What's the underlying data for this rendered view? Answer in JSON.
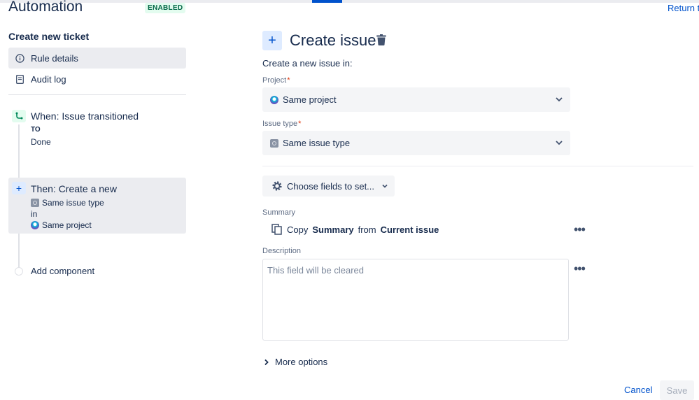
{
  "header": {
    "app_title": "Automation",
    "status_badge": "ENABLED",
    "return_link": "Return t"
  },
  "sidebar": {
    "rule_name": "Create new ticket",
    "nav": [
      {
        "label": "Rule details",
        "icon": "info-icon"
      },
      {
        "label": "Audit log",
        "icon": "document-icon"
      }
    ],
    "trigger": {
      "title": "When: Issue transitioned",
      "to_label": "TO",
      "to_value": "Done"
    },
    "action": {
      "title": "Then: Create a new",
      "issue_type": "Same issue type",
      "in_label": "in",
      "project": "Same project"
    },
    "add_component": "Add component"
  },
  "main": {
    "title": "Create issue",
    "subtitle": "Create a new issue in:",
    "project_label": "Project",
    "project_value": "Same project",
    "issue_type_label": "Issue type",
    "issue_type_value": "Same issue type",
    "choose_fields": "Choose fields to set...",
    "summary_label": "Summary",
    "summary_copy": {
      "prefix": "Copy",
      "field": "Summary",
      "middle": "from",
      "source": "Current issue"
    },
    "description_label": "Description",
    "description_placeholder": "This field will be cleared",
    "more_options": "More options",
    "required_mark": "*"
  },
  "footer": {
    "cancel": "Cancel",
    "save": "Save"
  },
  "colors": {
    "primary": "#0052cc",
    "text": "#172b4d",
    "badge_bg": "#e3fcef",
    "badge_text": "#006644",
    "required": "#de350b"
  }
}
